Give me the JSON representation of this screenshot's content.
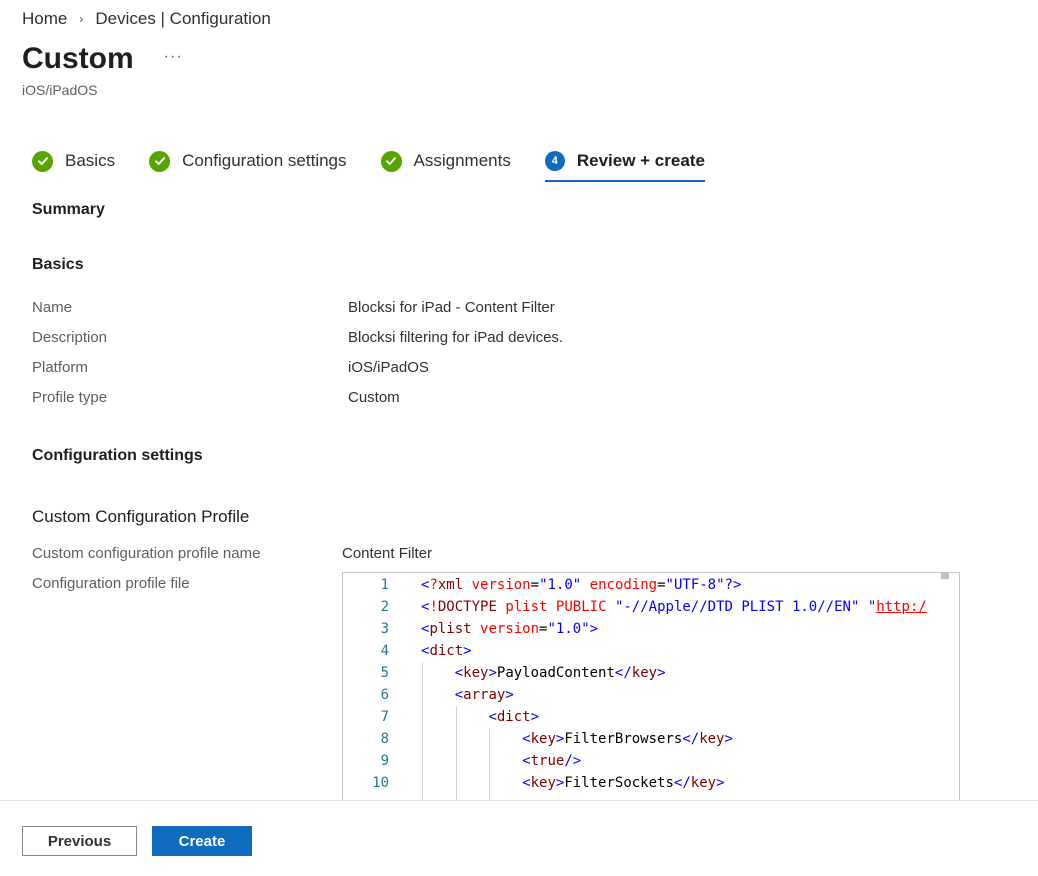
{
  "breadcrumb": {
    "items": [
      "Home",
      "Devices | Configuration"
    ],
    "separator": "›"
  },
  "header": {
    "title": "Custom",
    "more_label": "···",
    "subtitle": "iOS/iPadOS"
  },
  "wizard": {
    "steps": [
      {
        "label": "Basics",
        "status": "complete"
      },
      {
        "label": "Configuration settings",
        "status": "complete"
      },
      {
        "label": "Assignments",
        "status": "complete"
      },
      {
        "label": "Review + create",
        "status": "active",
        "number": "4"
      }
    ]
  },
  "summary": {
    "title": "Summary",
    "basics": {
      "title": "Basics",
      "rows": [
        {
          "label": "Name",
          "value": "Blocksi for iPad - Content Filter"
        },
        {
          "label": "Description",
          "value": "Blocksi filtering for iPad devices."
        },
        {
          "label": "Platform",
          "value": "iOS/iPadOS"
        },
        {
          "label": "Profile type",
          "value": "Custom"
        }
      ]
    },
    "config": {
      "title": "Configuration settings",
      "subtitle": "Custom Configuration Profile",
      "profile_name_label": "Custom configuration profile name",
      "profile_name_value": "Content Filter",
      "profile_file_label": "Configuration profile file"
    }
  },
  "editor": {
    "line_numbers": [
      "1",
      "2",
      "3",
      "4",
      "5",
      "6",
      "7",
      "8",
      "9",
      "10"
    ],
    "lines": [
      "<?xml version=\"1.0\" encoding=\"UTF-8\"?>",
      "<!DOCTYPE plist PUBLIC \"-//Apple//DTD PLIST 1.0//EN\" \"http:/",
      "<plist version=\"1.0\">",
      "<dict>",
      "    <key>PayloadContent</key>",
      "    <array>",
      "        <dict>",
      "            <key>FilterBrowsers</key>",
      "            <true/>",
      "            <key>FilterSockets</key>"
    ]
  },
  "footer": {
    "previous_label": "Previous",
    "create_label": "Create"
  },
  "colors": {
    "accent": "#0f6cbd",
    "success": "#57a300"
  }
}
